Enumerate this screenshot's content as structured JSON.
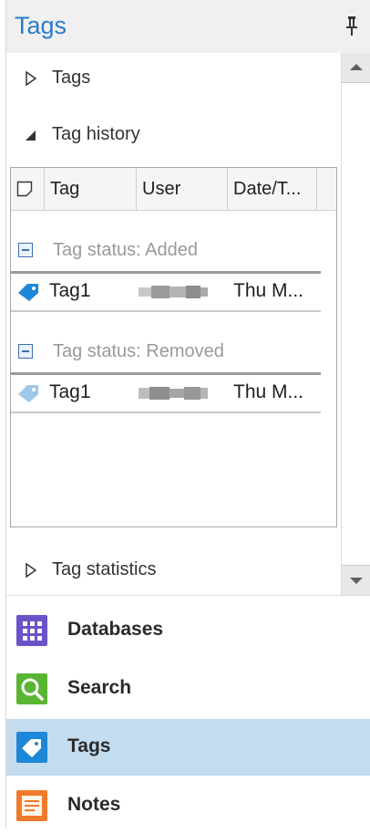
{
  "header": {
    "title": "Tags"
  },
  "sections": {
    "tags": "Tags",
    "tag_history": "Tag history",
    "tag_statistics": "Tag statistics"
  },
  "grid": {
    "columns": [
      "Tag",
      "User",
      "Date/T..."
    ],
    "groups": [
      {
        "title": "Tag status: Added",
        "rows": [
          {
            "tag": "Tag1",
            "user": "",
            "date": "Thu M..."
          }
        ]
      },
      {
        "title": "Tag status: Removed",
        "rows": [
          {
            "tag": "Tag1",
            "user": "",
            "date": "Thu M..."
          }
        ]
      }
    ]
  },
  "nav": {
    "items": [
      {
        "label": "Databases",
        "icon": "databases-icon"
      },
      {
        "label": "Search",
        "icon": "search-icon"
      },
      {
        "label": "Tags",
        "icon": "tags-icon"
      },
      {
        "label": "Notes",
        "icon": "notes-icon"
      }
    ],
    "active": "Tags"
  },
  "colors": {
    "accent": "#2a7ccc",
    "active_nav": "#c3dcef",
    "databases": "#6b52c9",
    "search": "#5ab532",
    "tags": "#1e88d8",
    "notes": "#f07a2b"
  }
}
